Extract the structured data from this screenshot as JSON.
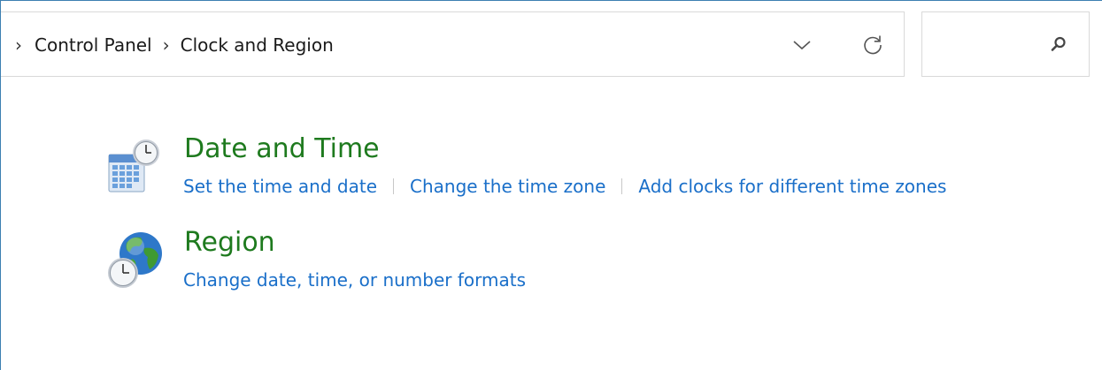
{
  "address_bar": {
    "breadcrumb": [
      {
        "label": "Control Panel"
      },
      {
        "label": "Clock and Region"
      }
    ],
    "dropdown_icon": "chevron-down-icon",
    "refresh_icon": "refresh-icon"
  },
  "search": {
    "placeholder": "",
    "icon": "search-icon"
  },
  "categories": [
    {
      "title": "Date and Time",
      "icon": "date-time-icon",
      "links": [
        "Set the time and date",
        "Change the time zone",
        "Add clocks for different time zones"
      ]
    },
    {
      "title": "Region",
      "icon": "region-globe-icon",
      "links": [
        "Change date, time, or number formats"
      ]
    }
  ],
  "colors": {
    "title_green": "#1e7a1e",
    "link_blue": "#1a6fc9",
    "window_border": "#3c7fb1"
  }
}
